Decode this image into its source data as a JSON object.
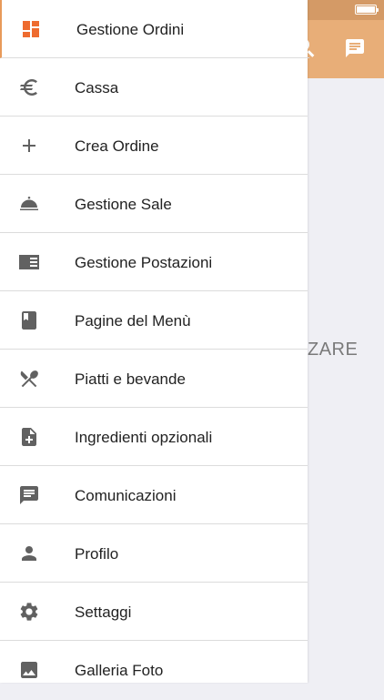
{
  "background": {
    "overlay_text": "ZARE",
    "statusbar_color": "#d49a66",
    "appbar_color": "#e8ae78",
    "icons": [
      "search-icon",
      "chat-icon"
    ]
  },
  "drawer": {
    "accent_color": "#ee6b2f",
    "icon_color": "#616161",
    "items": [
      {
        "label": "Gestione Ordini",
        "icon": "dashboard-icon"
      },
      {
        "label": "Cassa",
        "icon": "euro-icon"
      },
      {
        "label": "Crea Ordine",
        "icon": "plus-icon"
      },
      {
        "label": "Gestione Sale",
        "icon": "cloche-icon"
      },
      {
        "label": "Gestione Postazioni",
        "icon": "postazioni-icon"
      },
      {
        "label": "Pagine del Menù",
        "icon": "book-icon"
      },
      {
        "label": "Piatti e bevande",
        "icon": "utensils-icon"
      },
      {
        "label": "Ingredienti opzionali",
        "icon": "note-add-icon"
      },
      {
        "label": "Comunicazioni",
        "icon": "message-icon"
      },
      {
        "label": "Profilo",
        "icon": "person-icon"
      },
      {
        "label": "Settaggi",
        "icon": "gear-icon"
      },
      {
        "label": "Galleria Foto",
        "icon": "image-icon"
      }
    ]
  }
}
